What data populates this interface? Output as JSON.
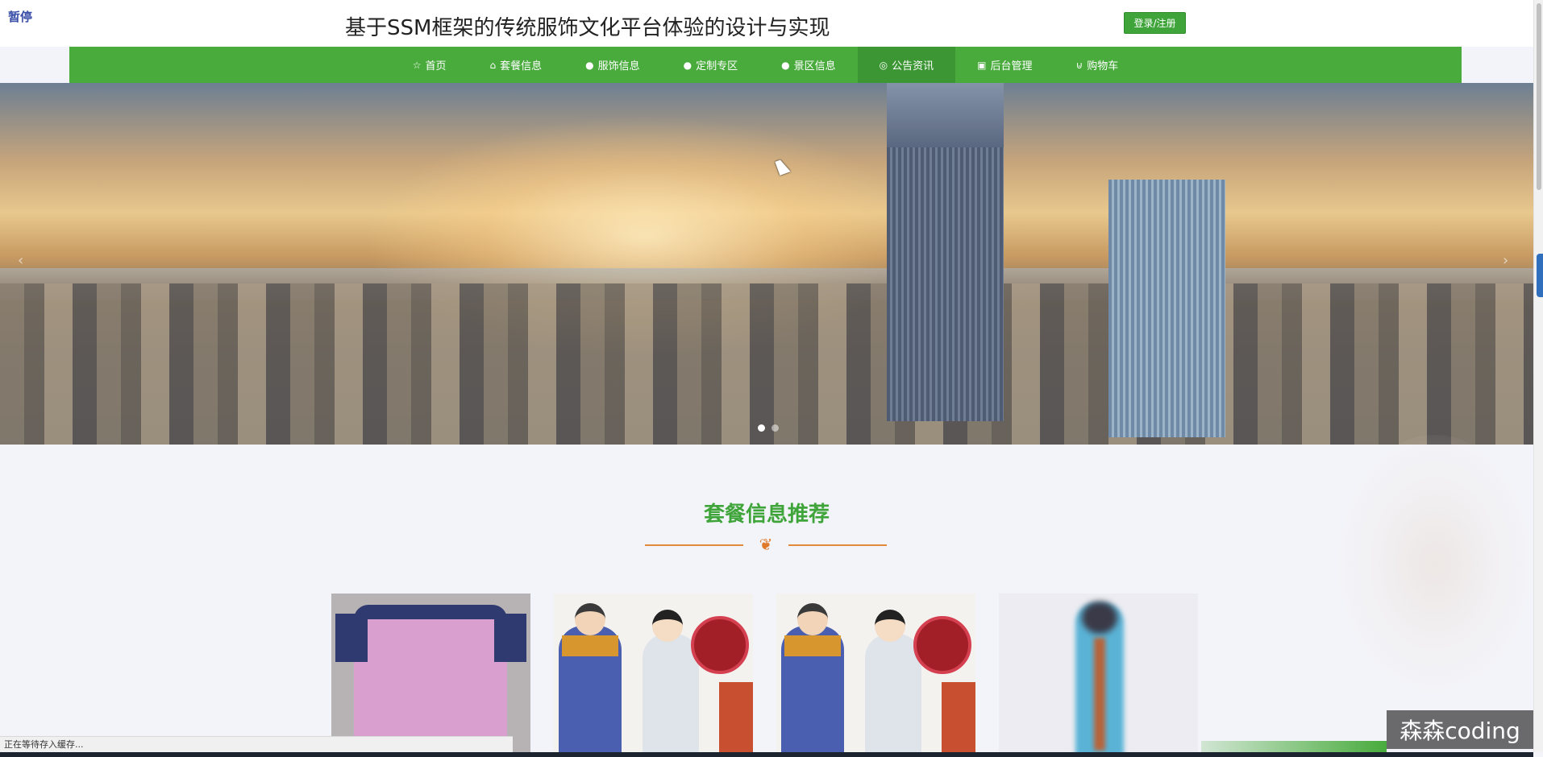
{
  "overlay": {
    "pause_label": "暂停"
  },
  "header": {
    "title": "基于SSM框架的传统服饰文化平台体验的设计与实现",
    "login_label": "登录/注册"
  },
  "nav": {
    "items": [
      {
        "label": "首页",
        "icon": "star-icon"
      },
      {
        "label": "套餐信息",
        "icon": "house-icon"
      },
      {
        "label": "服饰信息",
        "icon": "circle-icon"
      },
      {
        "label": "定制专区",
        "icon": "circle-icon"
      },
      {
        "label": "景区信息",
        "icon": "info-icon"
      },
      {
        "label": "公告资讯",
        "icon": "target-icon"
      },
      {
        "label": "后台管理",
        "icon": "briefcase-icon"
      },
      {
        "label": "购物车",
        "icon": "cart-icon"
      }
    ],
    "active_item": "公告资讯",
    "accent_color": "#48ab3c"
  },
  "banner": {
    "slides": 2,
    "active_slide": 1
  },
  "section": {
    "title": "套餐信息推荐",
    "cards": [
      {
        "image": "qing-dynasty-robe"
      },
      {
        "image": "traditional-costume-illustration"
      },
      {
        "image": "traditional-costume-illustration"
      },
      {
        "image": "person-in-blue-hanfu"
      }
    ]
  },
  "status_bar": {
    "text": "正在等待存入缓存..."
  },
  "watermark": {
    "text": "森森coding"
  }
}
